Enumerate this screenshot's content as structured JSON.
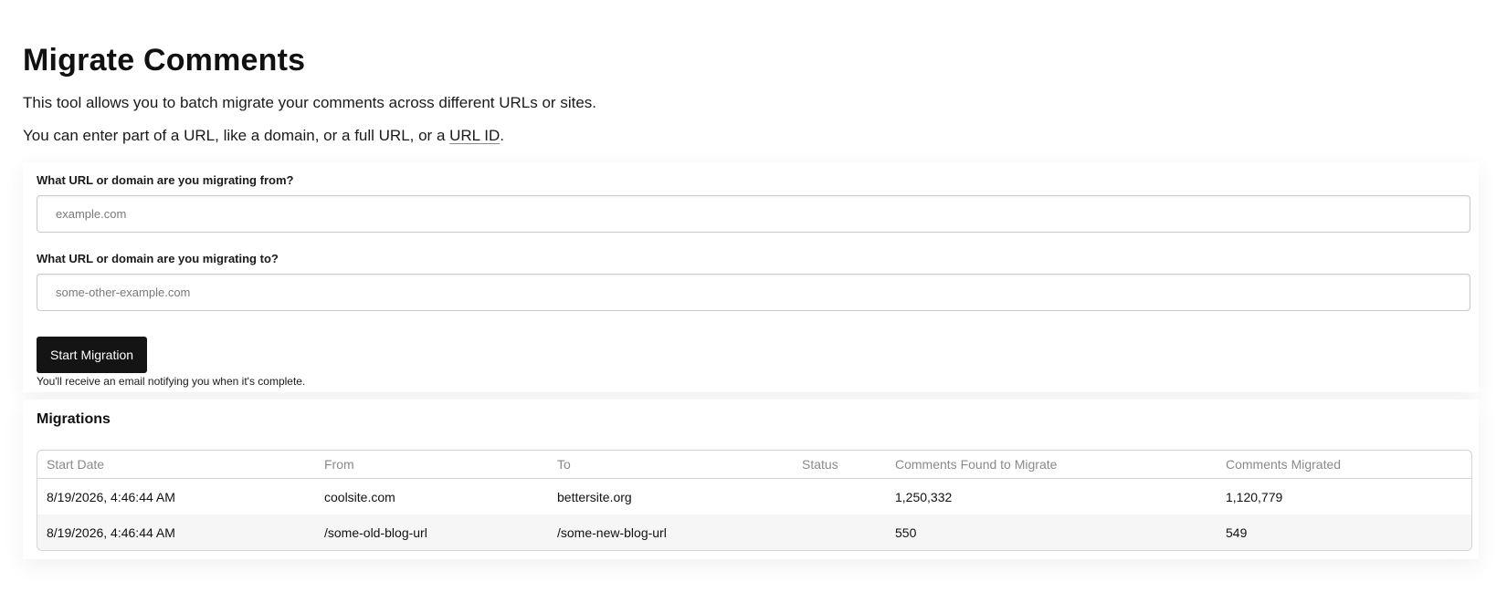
{
  "page": {
    "title": "Migrate Comments",
    "intro_line_1": "This tool allows you to batch migrate your comments across different URLs or sites.",
    "intro_line_2_prefix": "You can enter part of a URL, like a domain, or a full URL, or a ",
    "intro_line_2_link": "URL ID",
    "intro_line_2_suffix": "."
  },
  "form": {
    "from_label": "What URL or domain are you migrating from?",
    "from_placeholder": "example.com",
    "from_value": "",
    "to_label": "What URL or domain are you migrating to?",
    "to_placeholder": "some-other-example.com",
    "to_value": "",
    "submit_label": "Start Migration",
    "help_text": "You'll receive an email notifying you when it's complete."
  },
  "migrations": {
    "title": "Migrations",
    "columns": {
      "start_date": "Start Date",
      "from": "From",
      "to": "To",
      "status": "Status",
      "found": "Comments Found to Migrate",
      "migrated": "Comments Migrated"
    },
    "rows": [
      {
        "start_date": "8/19/2026, 4:46:44 AM",
        "from": "coolsite.com",
        "to": "bettersite.org",
        "status": "",
        "found": "1,250,332",
        "migrated": "1,120,779"
      },
      {
        "start_date": "8/19/2026, 4:46:44 AM",
        "from": "/some-old-blog-url",
        "to": "/some-new-blog-url",
        "status": "",
        "found": "550",
        "migrated": "549"
      }
    ]
  },
  "colors": {
    "button_bg": "#141414",
    "text": "#111111",
    "header_text": "#8a8a8a",
    "row_alt_bg": "#f6f6f6",
    "border": "#d4d4d4"
  }
}
